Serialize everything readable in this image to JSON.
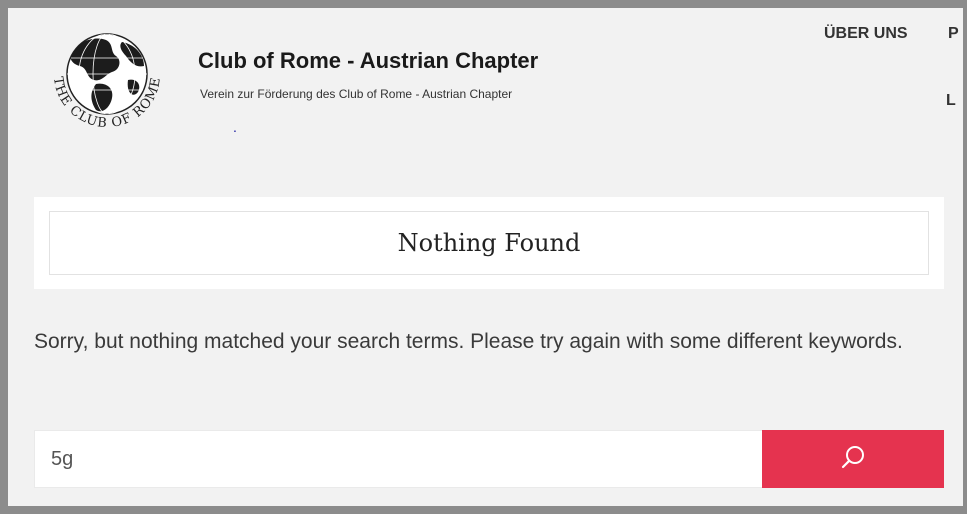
{
  "site": {
    "title": "Club of Rome - Austrian Chapter",
    "tagline": "Verein zur Förderung des Club of Rome - Austrian Chapter",
    "logo_text": "THE CLUB OF ROME"
  },
  "nav": {
    "items": [
      {
        "label": "ÜBER UNS"
      },
      {
        "label": "P"
      },
      {
        "label": "L"
      }
    ]
  },
  "main": {
    "title": "Nothing Found",
    "message": "Sorry, but nothing matched your search terms. Please try again with some different keywords."
  },
  "search": {
    "value": "5g",
    "button_icon": "search-icon"
  },
  "colors": {
    "accent": "#e5334f",
    "background": "#f2f2f2",
    "frame": "#8c8c8c"
  }
}
